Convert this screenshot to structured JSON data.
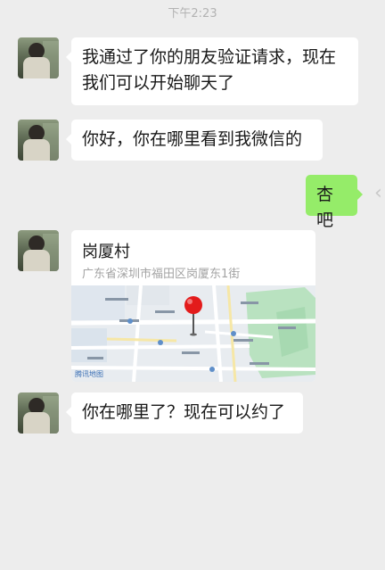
{
  "status_time": "下午2:23",
  "messages": [
    {
      "side": "left",
      "text_line1": "我通过了你的朋友验证请求，现在",
      "text_line2": "我们可以开始聊天了"
    },
    {
      "side": "left",
      "text": "你好，你在哪里看到我微信的"
    },
    {
      "side": "right",
      "text": "杏吧"
    },
    {
      "side": "left",
      "type": "location",
      "title": "岗厦村",
      "address": "广东省深圳市福田区岗厦东1街",
      "map_logo": "腾讯地图"
    },
    {
      "side": "left",
      "text": "你在哪里了？现在可以约了"
    }
  ],
  "colors": {
    "background": "#ededed",
    "bubble_left": "#ffffff",
    "bubble_right": "#95ec69",
    "pin": "#e31b1b"
  }
}
